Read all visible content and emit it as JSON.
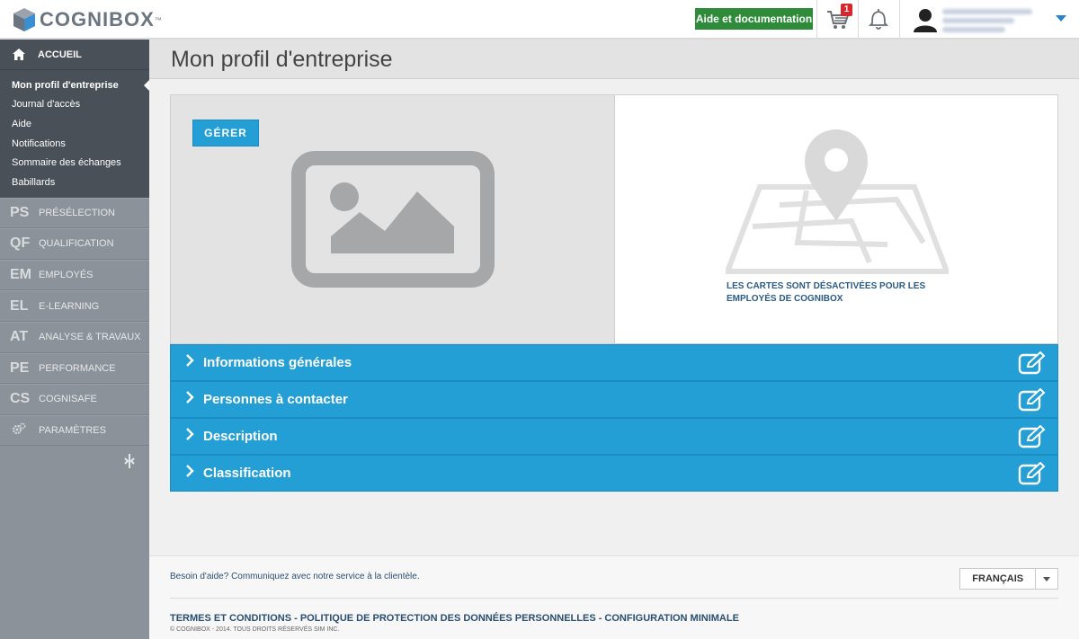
{
  "app": {
    "logo_text": "COGNIBOX",
    "logo_tm": "™"
  },
  "header": {
    "help_label": "Aide et documentation",
    "cart_count": "1",
    "icons": [
      "cart-icon",
      "bell-icon",
      "user-avatar-icon",
      "caret-down-icon"
    ]
  },
  "sidebar": {
    "home_label": "ACCUEIL",
    "sub_items": [
      {
        "label": "Mon profil d'entreprise",
        "active": true
      },
      {
        "label": "Journal d'accès"
      },
      {
        "label": "Aide"
      },
      {
        "label": "Notifications"
      },
      {
        "label": "Sommaire des échanges"
      },
      {
        "label": "Babillards"
      }
    ],
    "modules": [
      {
        "abbr": "PS",
        "label": "PRÉSÉLECTION"
      },
      {
        "abbr": "QF",
        "label": "QUALIFICATION"
      },
      {
        "abbr": "EM",
        "label": "EMPLOYÉS"
      },
      {
        "abbr": "EL",
        "label": "E-LEARNING"
      },
      {
        "abbr": "AT",
        "label": "ANALYSE & TRAVAUX"
      },
      {
        "abbr": "PE",
        "label": "PERFORMANCE"
      },
      {
        "abbr": "CS",
        "label": "COGNISAFE"
      },
      {
        "abbr": "",
        "label": "PARAMÈTRES",
        "icon": "gear-icon"
      }
    ]
  },
  "main": {
    "title": "Mon profil d'entreprise",
    "manage_label": "GÉRER",
    "map_note": "LES CARTES SONT DÉSACTIVÉES POUR LES EMPLOYÉS DE COGNIBOX",
    "sections": [
      {
        "label": "Informations générales"
      },
      {
        "label": "Personnes à contacter"
      },
      {
        "label": "Description"
      },
      {
        "label": "Classification"
      }
    ]
  },
  "footer": {
    "help_text": "Besoin d'aide? Communiquez avec notre service à la clientèle.",
    "language": "FRANÇAIS",
    "links": "TERMES ET CONDITIONS - POLITIQUE DE PROTECTION DES DONNÉES PERSONNELLES - CONFIGURATION MINIMALE",
    "copyright": "© COGNIBOX - 2014. TOUS DROITS RÉSERVÉS SIM INC."
  },
  "colors": {
    "accent_blue": "#239fd5",
    "help_green": "#2e8b3a",
    "badge_red": "#d9262c",
    "sidebar_dark": "#4a5058",
    "sidebar_light": "#8c9299"
  }
}
